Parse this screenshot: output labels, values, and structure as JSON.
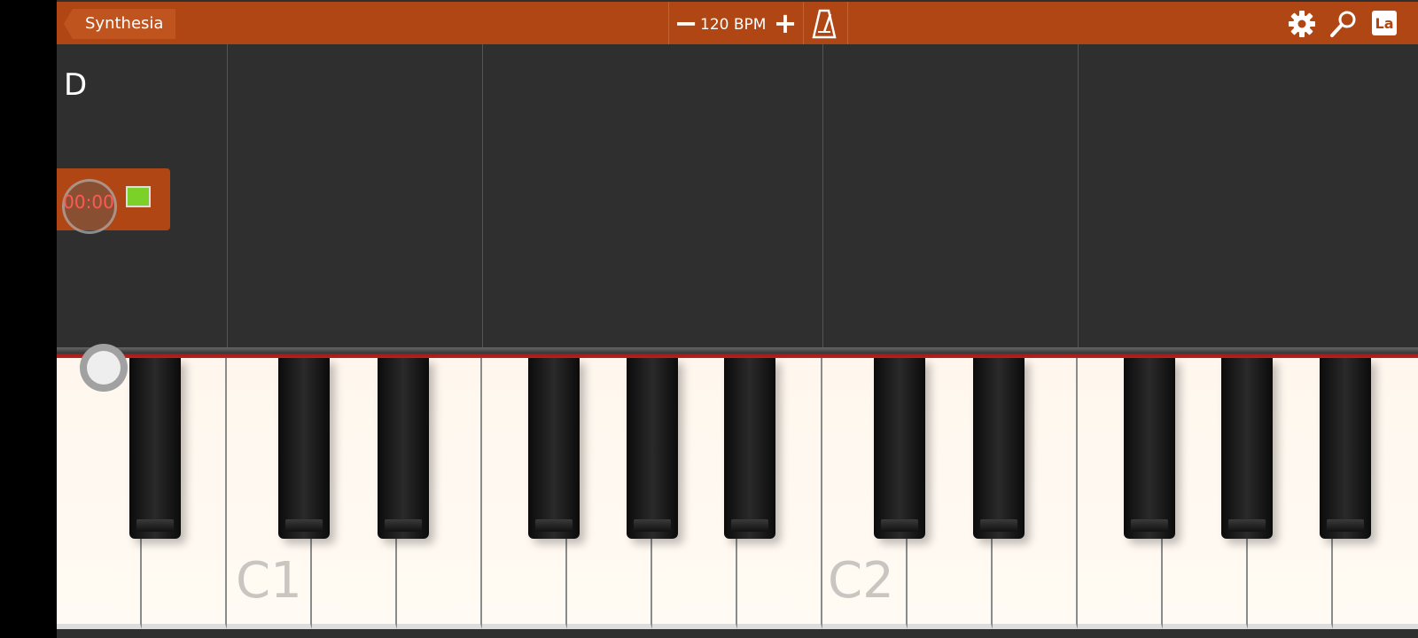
{
  "topbar": {
    "back_label": "Synthesia",
    "bpm_text": "120 BPM",
    "bpm_minus": "−",
    "bpm_plus": "+",
    "note_label_button": "La"
  },
  "song": {
    "key_label": "D",
    "timer": "00:00",
    "track_color": "#7cd128"
  },
  "keyboard": {
    "labels": [
      "C1",
      "C2"
    ]
  },
  "icons": [
    "metronome-icon",
    "gear-icon",
    "zoom-icon"
  ],
  "colors": {
    "accent": "#b04613",
    "background": "#2f2f2f",
    "recorder_red": "#ff5a52"
  }
}
